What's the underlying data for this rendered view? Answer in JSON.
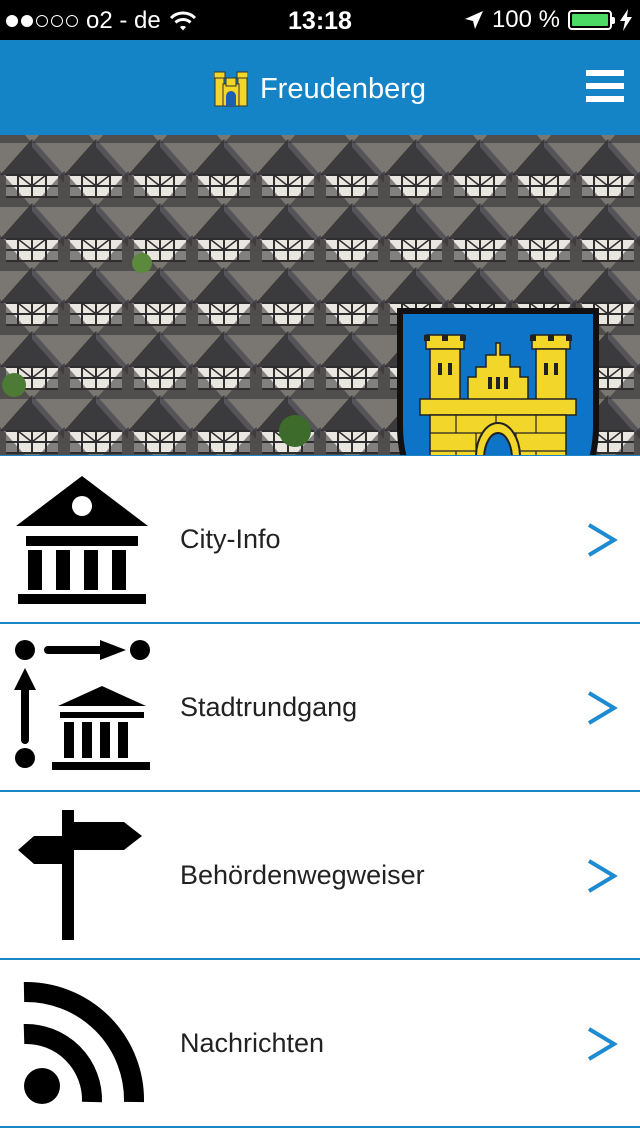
{
  "status_bar": {
    "carrier": "o2 - de",
    "time": "13:18",
    "battery_percent": "100 %",
    "signal_bars_filled": 2,
    "signal_bars_total": 5,
    "battery_level": 1.0
  },
  "nav": {
    "title": "Freudenberg",
    "menu_icon": "hamburger-icon",
    "logo_icon": "castle-icon"
  },
  "hero": {
    "coat_of_arms": "coat-of-arms-icon",
    "image_subject": "town-houses"
  },
  "menu": {
    "items": [
      {
        "label": "City-Info",
        "icon": "museum-icon"
      },
      {
        "label": "Stadtrundgang",
        "icon": "tour-route-icon"
      },
      {
        "label": "Behördenwegweiser",
        "icon": "signpost-icon"
      },
      {
        "label": "Nachrichten",
        "icon": "rss-icon"
      }
    ]
  },
  "colors": {
    "nav_background": "#1584c7",
    "divider": "#1b84c6",
    "chevron": "#1e8ad1",
    "coat_yellow": "#f3d62a",
    "coat_blue": "#0d74c8"
  }
}
